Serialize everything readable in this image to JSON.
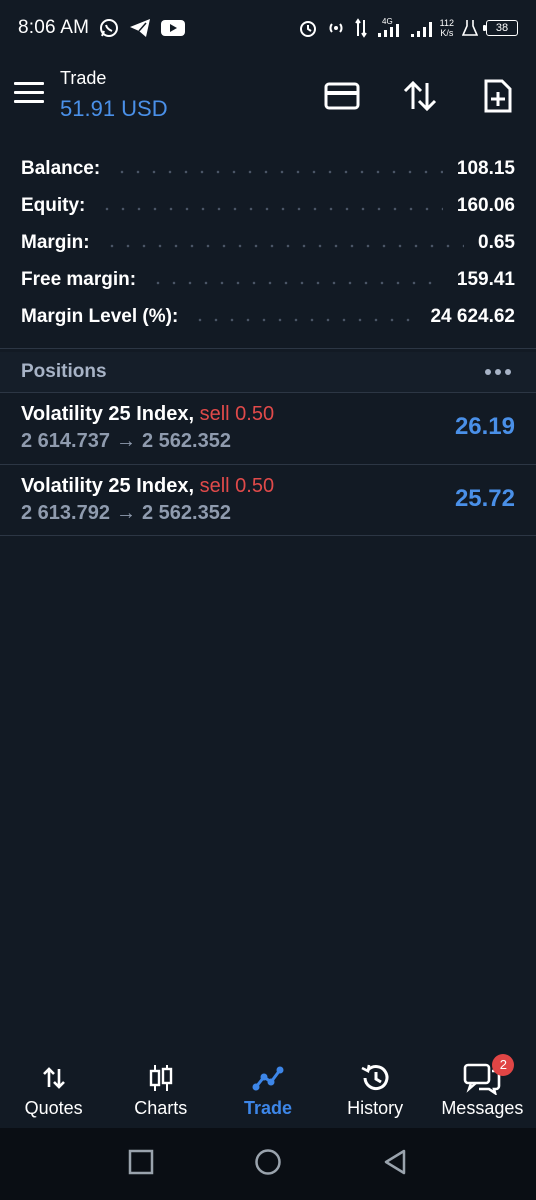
{
  "status_bar": {
    "time": "8:06 AM",
    "net_speed_value": "112",
    "net_speed_unit": "K/s",
    "network_type": "4G",
    "battery": "38"
  },
  "header": {
    "title": "Trade",
    "subtitle": "51.91 USD"
  },
  "summary": [
    {
      "label": "Balance:",
      "value": "108.15"
    },
    {
      "label": "Equity:",
      "value": "160.06"
    },
    {
      "label": "Margin:",
      "value": "0.65"
    },
    {
      "label": "Free margin:",
      "value": "159.41"
    },
    {
      "label": "Margin Level (%):",
      "value": "24 624.62"
    }
  ],
  "positions": {
    "title": "Positions",
    "items": [
      {
        "symbol": "Volatility 25 Index,",
        "side": "sell 0.50",
        "open_price": "2 614.737",
        "arrow": "→",
        "current_price": "2 562.352",
        "profit": "26.19"
      },
      {
        "symbol": "Volatility 25 Index,",
        "side": "sell 0.50",
        "open_price": "2 613.792",
        "arrow": "→",
        "current_price": "2 562.352",
        "profit": "25.72"
      }
    ]
  },
  "bottom_nav": [
    {
      "label": "Quotes",
      "icon": "quotes-arrows-icon"
    },
    {
      "label": "Charts",
      "icon": "candlestick-icon"
    },
    {
      "label": "Trade",
      "icon": "trade-line-icon",
      "active": true
    },
    {
      "label": "History",
      "icon": "history-icon"
    },
    {
      "label": "Messages",
      "icon": "messages-icon",
      "badge": "2"
    }
  ],
  "colors": {
    "background": "#121a24",
    "accent": "#4a90e8",
    "sell": "#e04a4a",
    "muted": "#8f9bae"
  }
}
